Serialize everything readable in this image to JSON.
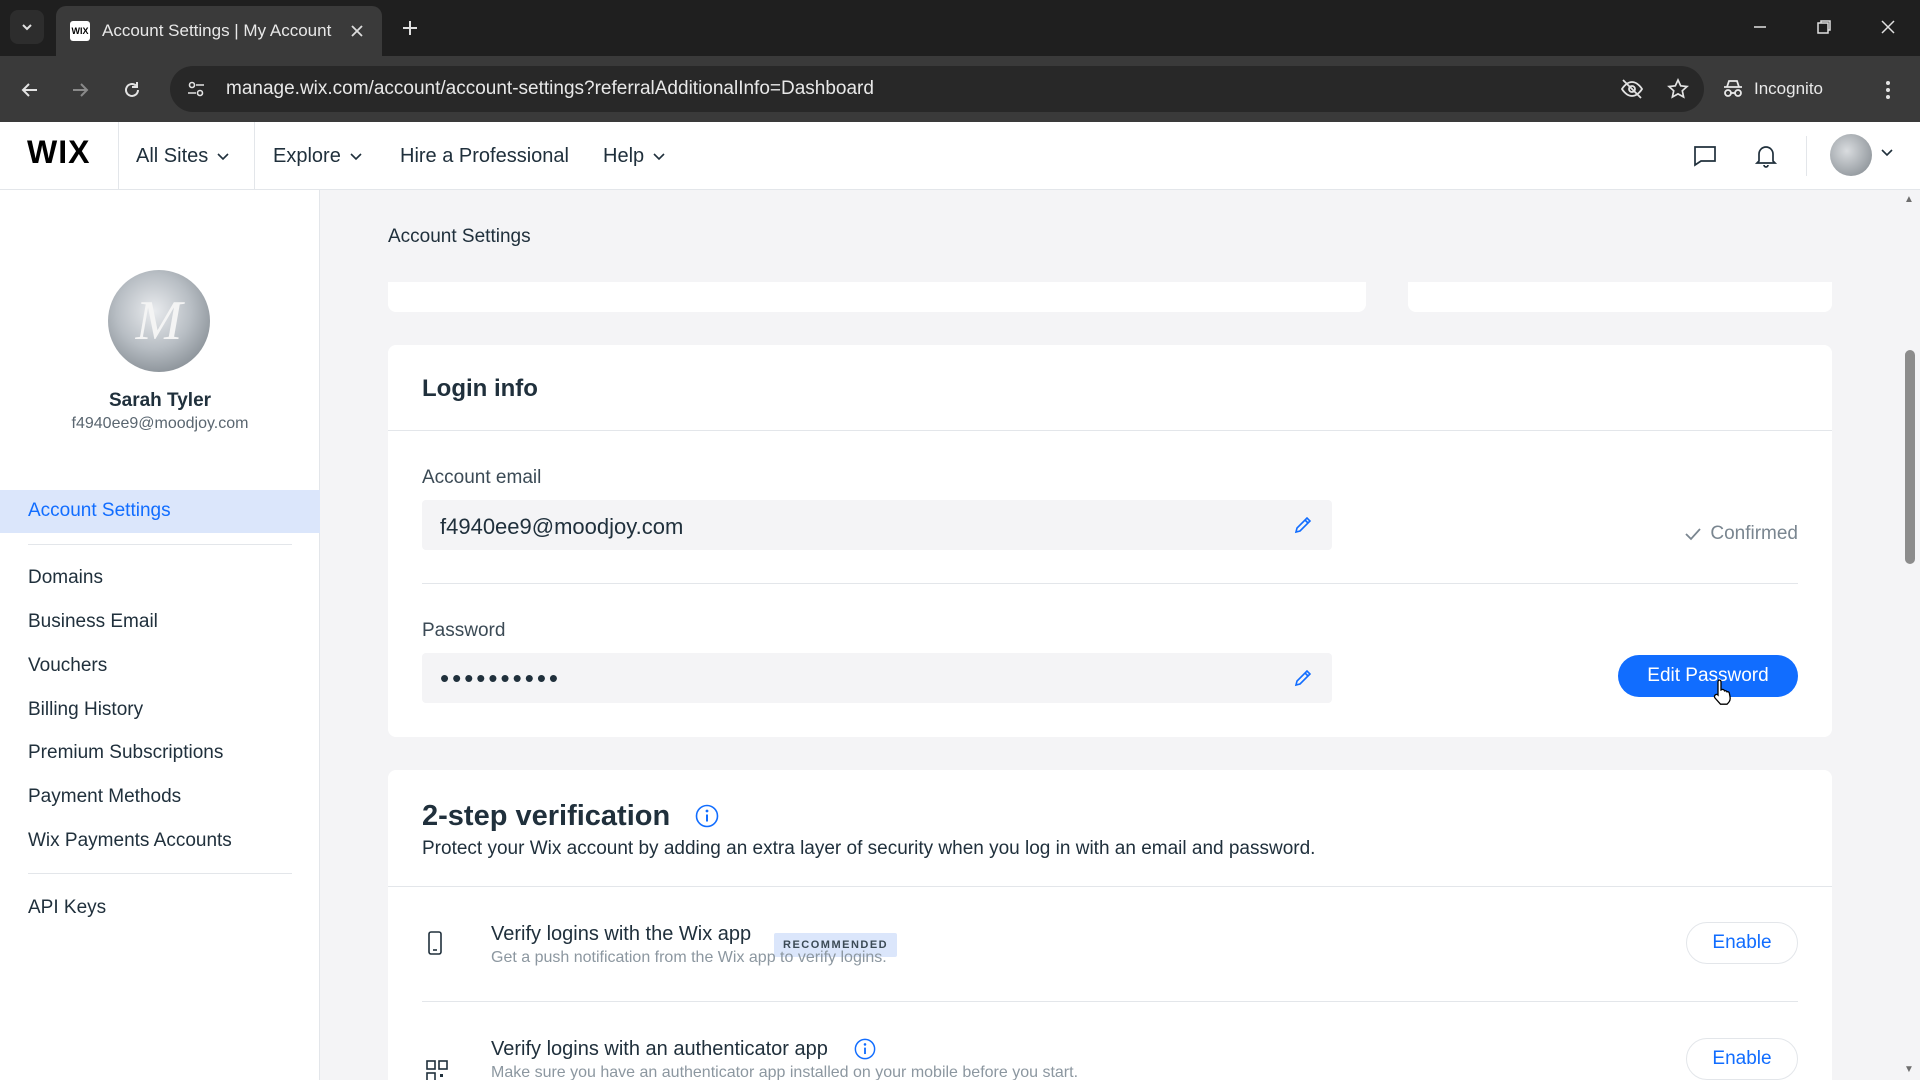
{
  "browser": {
    "tab_title": "Account Settings | My Account",
    "favicon_text": "WIX",
    "url": "manage.wix.com/account/account-settings?referralAdditionalInfo=Dashboard",
    "incognito_label": "Incognito"
  },
  "header": {
    "logo": "WIX",
    "nav": {
      "all_sites": "All Sites",
      "explore": "Explore",
      "hire": "Hire a Professional",
      "help": "Help"
    }
  },
  "sidebar": {
    "name": "Sarah Tyler",
    "email": "f4940ee9@moodjoy.com",
    "avatar_letter": "M",
    "active_item": "Account Settings",
    "items": [
      "Domains",
      "Business Email",
      "Vouchers",
      "Billing History",
      "Premium Subscriptions",
      "Payment Methods",
      "Wix Payments Accounts"
    ],
    "footer_item": "API Keys"
  },
  "main": {
    "page_title": "Account Settings",
    "login_info": {
      "title": "Login info",
      "email_label": "Account email",
      "email_value": "f4940ee9@moodjoy.com",
      "confirmed": "Confirmed",
      "password_label": "Password",
      "password_value": "••••••••••",
      "edit_password": "Edit Password"
    },
    "two_step": {
      "title": "2-step verification",
      "description": "Protect your Wix account by adding an extra layer of security when you log in with an email and password.",
      "options": [
        {
          "title": "Verify logins with the Wix app",
          "badge": "RECOMMENDED",
          "subtitle": "Get a push notification from the Wix app to verify logins.",
          "button": "Enable"
        },
        {
          "title": "Verify logins with an authenticator app",
          "subtitle": "Make sure you have an authenticator app installed on your mobile before you start.",
          "button": "Enable"
        }
      ]
    }
  },
  "colors": {
    "accent": "#116dff",
    "active_bg": "#dbe6fb",
    "page_bg": "#f4f4f6",
    "text": "#20303c"
  }
}
